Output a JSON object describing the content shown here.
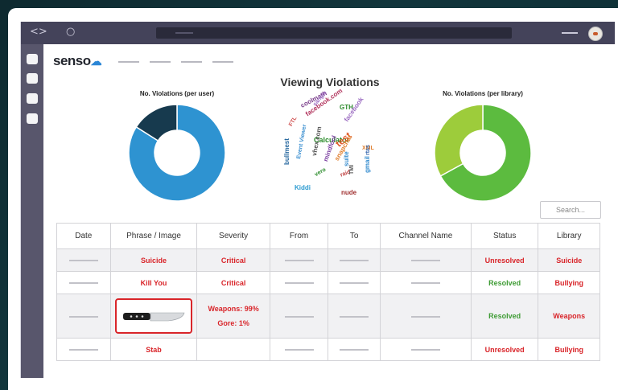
{
  "app": {
    "logo_text": "senso",
    "logo_icon": "cloud-icon"
  },
  "page": {
    "title": "Viewing Violations"
  },
  "charts": {
    "left_title": "No. Violations (per user)",
    "right_title": "No. Violations (per library)"
  },
  "chart_data": [
    {
      "type": "pie",
      "title": "No. Violations (per user)",
      "values": [
        84,
        16
      ],
      "colors": [
        "#2e93d1",
        "#173a4e"
      ]
    },
    {
      "type": "pie",
      "title": "No. Violations (per library)",
      "values": [
        67,
        33
      ],
      "colors": [
        "#5cbb3f",
        "#9dcc3b"
      ]
    }
  ],
  "word_cloud": {
    "words": [
      "coolmath",
      "GTH",
      "facebook.com",
      "FTL",
      "Calculator",
      "test",
      "facebook",
      "snapchat",
      "bullmest",
      "Event Viewer",
      "suite",
      "vhex.com",
      "mindfool",
      "gmail",
      "XML",
      "Kiddi",
      "vero",
      "raid",
      "nude",
      "TMI",
      "rtas",
      "sangle"
    ]
  },
  "search": {
    "placeholder": "Search..."
  },
  "table": {
    "headers": [
      "Date",
      "Phrase / Image",
      "Severity",
      "From",
      "To",
      "Channel Name",
      "Status",
      "Library"
    ],
    "rows": [
      {
        "phrase": "Suicide",
        "severity_1": "Critical",
        "severity_2": "",
        "status": "Unresolved",
        "status_color": "red",
        "library": "Suicide"
      },
      {
        "phrase": "Kill You",
        "severity_1": "Critical",
        "severity_2": "",
        "status": "Resolved",
        "status_color": "green",
        "library": "Bullying"
      },
      {
        "phrase": "",
        "image": "knife-image",
        "severity_1": "Weapons: 99%",
        "severity_2": "Gore: 1%",
        "status": "Resolved",
        "status_color": "green",
        "library": "Weapons"
      },
      {
        "phrase": "Stab",
        "severity_1": "",
        "severity_2": "",
        "status": "Unresolved",
        "status_color": "red",
        "library": "Bullying"
      }
    ]
  },
  "colors": {
    "critical": "#d9252a",
    "resolved": "#3f9c35",
    "titlebar": "#44435a",
    "sidebar": "#58566c"
  }
}
